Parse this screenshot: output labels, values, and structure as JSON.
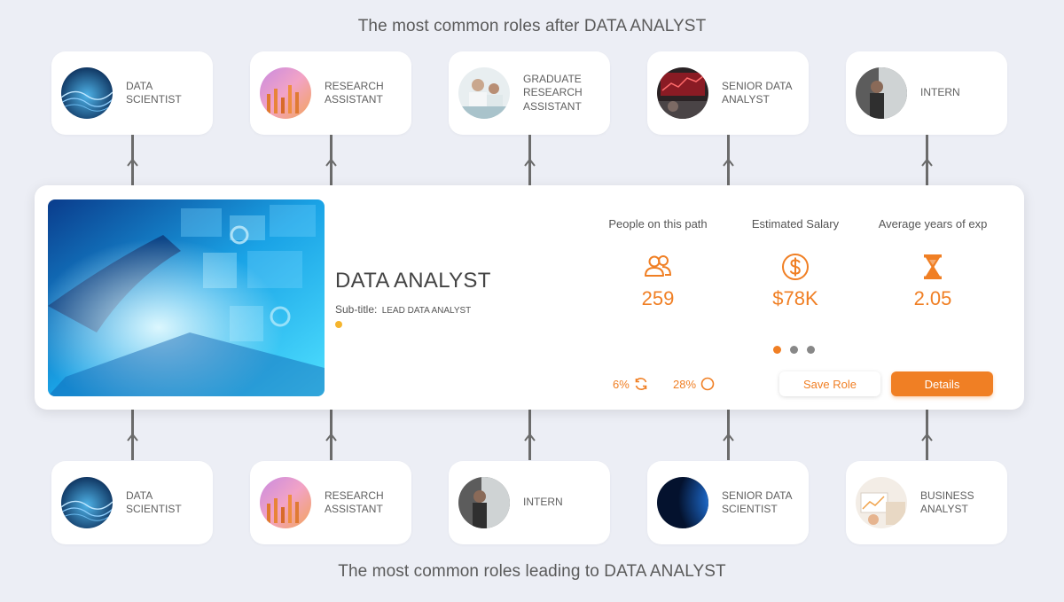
{
  "headings": {
    "after": "The most common roles after DATA ANALYST",
    "leading": "The most common roles leading to DATA ANALYST"
  },
  "roles_after": [
    {
      "label": "DATA SCIENTIST",
      "image": "data-scientist-photo"
    },
    {
      "label": "RESEARCH ASSISTANT",
      "image": "research-assistant-photo"
    },
    {
      "label": "GRADUATE RESEARCH ASSISTANT",
      "image": "graduate-research-assistant-photo"
    },
    {
      "label": "SENIOR DATA ANALYST",
      "image": "senior-data-analyst-photo"
    },
    {
      "label": "INTERN",
      "image": "intern-photo"
    }
  ],
  "roles_leading": [
    {
      "label": "DATA SCIENTIST",
      "image": "data-scientist-photo"
    },
    {
      "label": "RESEARCH ASSISTANT",
      "image": "research-assistant-photo"
    },
    {
      "label": "INTERN",
      "image": "intern-photo"
    },
    {
      "label": "SENIOR DATA SCIENTIST",
      "image": "senior-data-scientist-photo"
    },
    {
      "label": "BUSINESS ANALYST",
      "image": "business-analyst-photo"
    }
  ],
  "main": {
    "title": "DATA ANALYST",
    "subtitle_label": "Sub-title:",
    "subtitle_value": "LEAD DATA ANALYST",
    "hero_image": "data-analytics-touchscreen-photo",
    "stats": [
      {
        "label": "People on this path",
        "value": "259",
        "icon": "people-icon"
      },
      {
        "label": "Estimated Salary",
        "value": "$78K",
        "icon": "dollar-icon"
      },
      {
        "label": "Average years of exp",
        "value": "2.05",
        "icon": "hourglass-icon"
      }
    ],
    "pagination": {
      "count": 3,
      "active": 1
    },
    "metrics": [
      {
        "value": "6%",
        "icon": "refresh-icon"
      },
      {
        "value": "28%",
        "icon": "circle-icon"
      }
    ],
    "buttons": {
      "save": "Save Role",
      "details": "Details"
    }
  },
  "colors": {
    "accent": "#f07f24",
    "background": "#eceef5",
    "connector": "#6b6b6b",
    "subtitle_dot": "#f5b52e"
  }
}
